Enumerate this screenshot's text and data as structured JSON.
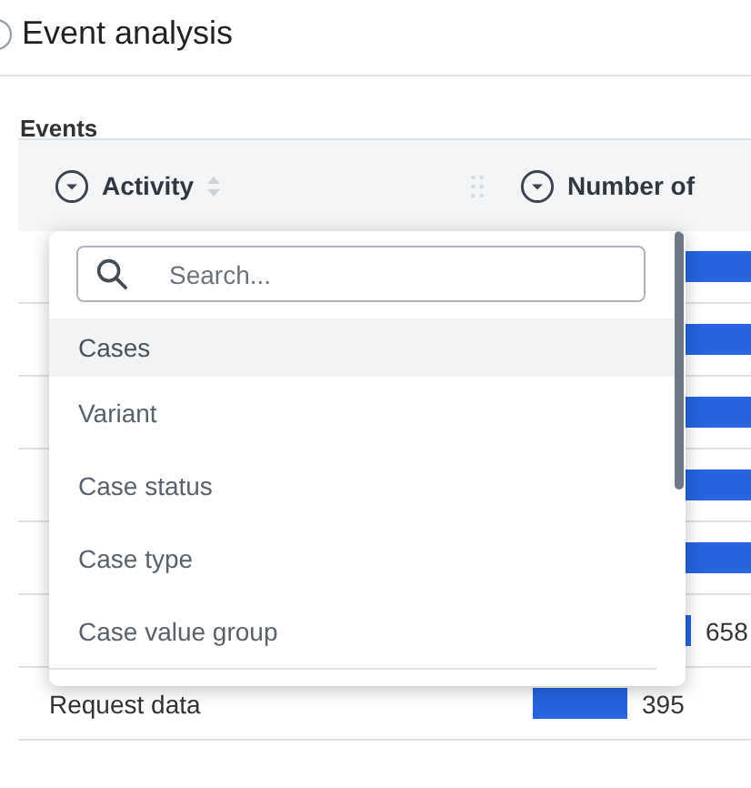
{
  "page": {
    "title": "Event analysis"
  },
  "section": {
    "title": "Events"
  },
  "table": {
    "columns": [
      {
        "label": "Activity",
        "sortable": true,
        "draggable": true
      },
      {
        "label": "Number of"
      }
    ],
    "rows": [
      {},
      {},
      {},
      {},
      {},
      {
        "value": "658"
      },
      {
        "activity": "Request data",
        "value": "395"
      }
    ]
  },
  "dropdown": {
    "search": {
      "placeholder": "Search..."
    },
    "items": [
      {
        "label": "Cases",
        "selected": true
      },
      {
        "label": "Variant",
        "selected": false
      },
      {
        "label": "Case status",
        "selected": false
      },
      {
        "label": "Case type",
        "selected": false
      },
      {
        "label": "Case value group",
        "selected": false
      }
    ]
  }
}
